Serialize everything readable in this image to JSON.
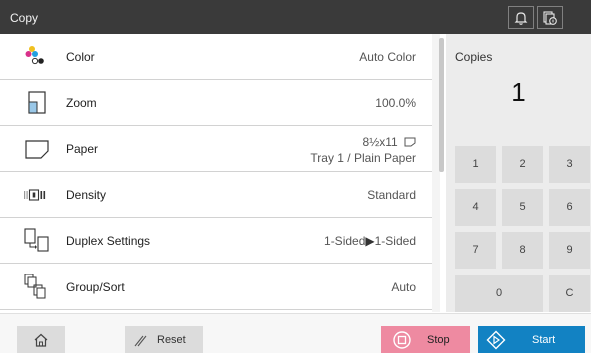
{
  "header": {
    "title": "Copy",
    "bell_icon": "bell-icon",
    "job_icon": "job-status-icon"
  },
  "settings": [
    {
      "label": "Color",
      "value": "Auto Color",
      "icon": "color-mode-icon"
    },
    {
      "label": "Zoom",
      "value": "100.0%",
      "icon": "zoom-icon"
    },
    {
      "label": "Paper",
      "value": "8½x11",
      "value2": "Tray 1 / Plain Paper",
      "icon": "paper-icon",
      "orientation_icon": "paper-orientation-icon"
    },
    {
      "label": "Density",
      "value": "Standard",
      "icon": "density-icon"
    },
    {
      "label": "Duplex Settings",
      "value": "1-Sided",
      "value_arrow": "▶",
      "value_end": "1-Sided",
      "icon": "duplex-icon"
    },
    {
      "label": "Group/Sort",
      "value": "Auto",
      "icon": "group-sort-icon"
    }
  ],
  "copies": {
    "label": "Copies",
    "value": "1"
  },
  "keypad": [
    "1",
    "2",
    "3",
    "4",
    "5",
    "6",
    "7",
    "8",
    "9",
    "0",
    "C"
  ],
  "footer": {
    "home_icon": "home-icon",
    "reset": "Reset",
    "stop": "Stop",
    "start": "Start"
  },
  "colors": {
    "titlebar": "#3a3a3a",
    "stop": "#ee8aa1",
    "start": "#1282c3",
    "panel": "#ececec"
  }
}
